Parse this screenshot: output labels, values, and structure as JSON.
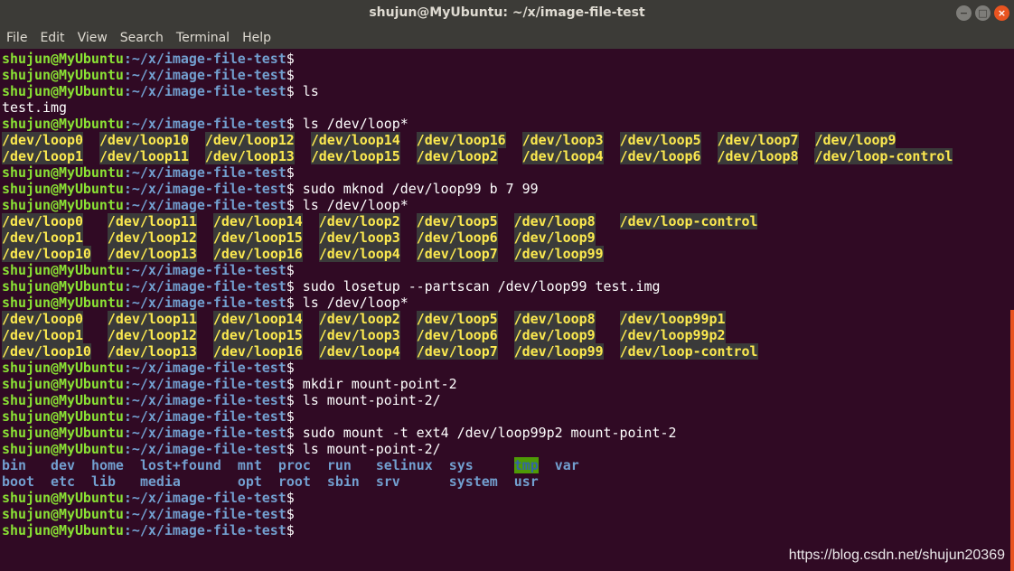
{
  "window": {
    "title": "shujun@MyUbuntu: ~/x/image-file-test",
    "buttons": {
      "minimize": "−",
      "maximize": "□",
      "close": "×"
    }
  },
  "menu": [
    "File",
    "Edit",
    "View",
    "Search",
    "Terminal",
    "Help"
  ],
  "prompt": {
    "user": "shujun@MyUbuntu",
    "path": ":~/x/image-file-test",
    "sign": "$ "
  },
  "lines": [
    {
      "t": "p",
      "cmd": ""
    },
    {
      "t": "p",
      "cmd": ""
    },
    {
      "t": "p",
      "cmd": "ls"
    },
    {
      "t": "o",
      "segs": [
        {
          "s": "test.img",
          "c": ""
        }
      ]
    },
    {
      "t": "p",
      "cmd": "ls /dev/loop*"
    },
    {
      "t": "o",
      "segs": [
        {
          "s": "/dev/loop0",
          "c": "dev"
        },
        {
          "s": "  ",
          "c": ""
        },
        {
          "s": "/dev/loop10",
          "c": "dev"
        },
        {
          "s": "  ",
          "c": ""
        },
        {
          "s": "/dev/loop12",
          "c": "dev"
        },
        {
          "s": "  ",
          "c": ""
        },
        {
          "s": "/dev/loop14",
          "c": "dev"
        },
        {
          "s": "  ",
          "c": ""
        },
        {
          "s": "/dev/loop16",
          "c": "dev"
        },
        {
          "s": "  ",
          "c": ""
        },
        {
          "s": "/dev/loop3",
          "c": "dev"
        },
        {
          "s": "  ",
          "c": ""
        },
        {
          "s": "/dev/loop5",
          "c": "dev"
        },
        {
          "s": "  ",
          "c": ""
        },
        {
          "s": "/dev/loop7",
          "c": "dev"
        },
        {
          "s": "  ",
          "c": ""
        },
        {
          "s": "/dev/loop9",
          "c": "dev"
        }
      ]
    },
    {
      "t": "o",
      "segs": [
        {
          "s": "/dev/loop1",
          "c": "dev"
        },
        {
          "s": "  ",
          "c": ""
        },
        {
          "s": "/dev/loop11",
          "c": "dev"
        },
        {
          "s": "  ",
          "c": ""
        },
        {
          "s": "/dev/loop13",
          "c": "dev"
        },
        {
          "s": "  ",
          "c": ""
        },
        {
          "s": "/dev/loop15",
          "c": "dev"
        },
        {
          "s": "  ",
          "c": ""
        },
        {
          "s": "/dev/loop2",
          "c": "dev"
        },
        {
          "s": "   ",
          "c": ""
        },
        {
          "s": "/dev/loop4",
          "c": "dev"
        },
        {
          "s": "  ",
          "c": ""
        },
        {
          "s": "/dev/loop6",
          "c": "dev"
        },
        {
          "s": "  ",
          "c": ""
        },
        {
          "s": "/dev/loop8",
          "c": "dev"
        },
        {
          "s": "  ",
          "c": ""
        },
        {
          "s": "/dev/loop-control",
          "c": "dev"
        }
      ]
    },
    {
      "t": "p",
      "cmd": ""
    },
    {
      "t": "p",
      "cmd": "sudo mknod /dev/loop99 b 7 99"
    },
    {
      "t": "p",
      "cmd": "ls /dev/loop*"
    },
    {
      "t": "o",
      "segs": [
        {
          "s": "/dev/loop0",
          "c": "dev"
        },
        {
          "s": "   ",
          "c": ""
        },
        {
          "s": "/dev/loop11",
          "c": "dev"
        },
        {
          "s": "  ",
          "c": ""
        },
        {
          "s": "/dev/loop14",
          "c": "dev"
        },
        {
          "s": "  ",
          "c": ""
        },
        {
          "s": "/dev/loop2",
          "c": "dev"
        },
        {
          "s": "  ",
          "c": ""
        },
        {
          "s": "/dev/loop5",
          "c": "dev"
        },
        {
          "s": "  ",
          "c": ""
        },
        {
          "s": "/dev/loop8",
          "c": "dev"
        },
        {
          "s": "   ",
          "c": ""
        },
        {
          "s": "/dev/loop-control",
          "c": "dev"
        }
      ]
    },
    {
      "t": "o",
      "segs": [
        {
          "s": "/dev/loop1",
          "c": "dev"
        },
        {
          "s": "   ",
          "c": ""
        },
        {
          "s": "/dev/loop12",
          "c": "dev"
        },
        {
          "s": "  ",
          "c": ""
        },
        {
          "s": "/dev/loop15",
          "c": "dev"
        },
        {
          "s": "  ",
          "c": ""
        },
        {
          "s": "/dev/loop3",
          "c": "dev"
        },
        {
          "s": "  ",
          "c": ""
        },
        {
          "s": "/dev/loop6",
          "c": "dev"
        },
        {
          "s": "  ",
          "c": ""
        },
        {
          "s": "/dev/loop9",
          "c": "dev"
        }
      ]
    },
    {
      "t": "o",
      "segs": [
        {
          "s": "/dev/loop10",
          "c": "dev"
        },
        {
          "s": "  ",
          "c": ""
        },
        {
          "s": "/dev/loop13",
          "c": "dev"
        },
        {
          "s": "  ",
          "c": ""
        },
        {
          "s": "/dev/loop16",
          "c": "dev"
        },
        {
          "s": "  ",
          "c": ""
        },
        {
          "s": "/dev/loop4",
          "c": "dev"
        },
        {
          "s": "  ",
          "c": ""
        },
        {
          "s": "/dev/loop7",
          "c": "dev"
        },
        {
          "s": "  ",
          "c": ""
        },
        {
          "s": "/dev/loop99",
          "c": "dev"
        }
      ]
    },
    {
      "t": "p",
      "cmd": ""
    },
    {
      "t": "p",
      "cmd": "sudo losetup --partscan /dev/loop99 test.img"
    },
    {
      "t": "p",
      "cmd": "ls /dev/loop*"
    },
    {
      "t": "o",
      "segs": [
        {
          "s": "/dev/loop0",
          "c": "dev"
        },
        {
          "s": "   ",
          "c": ""
        },
        {
          "s": "/dev/loop11",
          "c": "dev"
        },
        {
          "s": "  ",
          "c": ""
        },
        {
          "s": "/dev/loop14",
          "c": "dev"
        },
        {
          "s": "  ",
          "c": ""
        },
        {
          "s": "/dev/loop2",
          "c": "dev"
        },
        {
          "s": "  ",
          "c": ""
        },
        {
          "s": "/dev/loop5",
          "c": "dev"
        },
        {
          "s": "  ",
          "c": ""
        },
        {
          "s": "/dev/loop8",
          "c": "dev"
        },
        {
          "s": "   ",
          "c": ""
        },
        {
          "s": "/dev/loop99p1",
          "c": "dev"
        }
      ]
    },
    {
      "t": "o",
      "segs": [
        {
          "s": "/dev/loop1",
          "c": "dev"
        },
        {
          "s": "   ",
          "c": ""
        },
        {
          "s": "/dev/loop12",
          "c": "dev"
        },
        {
          "s": "  ",
          "c": ""
        },
        {
          "s": "/dev/loop15",
          "c": "dev"
        },
        {
          "s": "  ",
          "c": ""
        },
        {
          "s": "/dev/loop3",
          "c": "dev"
        },
        {
          "s": "  ",
          "c": ""
        },
        {
          "s": "/dev/loop6",
          "c": "dev"
        },
        {
          "s": "  ",
          "c": ""
        },
        {
          "s": "/dev/loop9",
          "c": "dev"
        },
        {
          "s": "   ",
          "c": ""
        },
        {
          "s": "/dev/loop99p2",
          "c": "dev"
        }
      ]
    },
    {
      "t": "o",
      "segs": [
        {
          "s": "/dev/loop10",
          "c": "dev"
        },
        {
          "s": "  ",
          "c": ""
        },
        {
          "s": "/dev/loop13",
          "c": "dev"
        },
        {
          "s": "  ",
          "c": ""
        },
        {
          "s": "/dev/loop16",
          "c": "dev"
        },
        {
          "s": "  ",
          "c": ""
        },
        {
          "s": "/dev/loop4",
          "c": "dev"
        },
        {
          "s": "  ",
          "c": ""
        },
        {
          "s": "/dev/loop7",
          "c": "dev"
        },
        {
          "s": "  ",
          "c": ""
        },
        {
          "s": "/dev/loop99",
          "c": "dev"
        },
        {
          "s": "  ",
          "c": ""
        },
        {
          "s": "/dev/loop-control",
          "c": "dev"
        }
      ]
    },
    {
      "t": "p",
      "cmd": ""
    },
    {
      "t": "p",
      "cmd": "mkdir mount-point-2"
    },
    {
      "t": "p",
      "cmd": "ls mount-point-2/"
    },
    {
      "t": "p",
      "cmd": ""
    },
    {
      "t": "p",
      "cmd": "sudo mount -t ext4 /dev/loop99p2 mount-point-2"
    },
    {
      "t": "p",
      "cmd": "ls mount-point-2/"
    },
    {
      "t": "o",
      "segs": [
        {
          "s": "bin",
          "c": "dir"
        },
        {
          "s": "   ",
          "c": ""
        },
        {
          "s": "dev",
          "c": "dir"
        },
        {
          "s": "  ",
          "c": ""
        },
        {
          "s": "home",
          "c": "dir"
        },
        {
          "s": "  ",
          "c": ""
        },
        {
          "s": "lost+found",
          "c": "dir"
        },
        {
          "s": "  ",
          "c": ""
        },
        {
          "s": "mnt",
          "c": "dir"
        },
        {
          "s": "  ",
          "c": ""
        },
        {
          "s": "proc",
          "c": "dir"
        },
        {
          "s": "  ",
          "c": ""
        },
        {
          "s": "run",
          "c": "dir"
        },
        {
          "s": "   ",
          "c": ""
        },
        {
          "s": "selinux",
          "c": "dir"
        },
        {
          "s": "  ",
          "c": ""
        },
        {
          "s": "sys",
          "c": "dir"
        },
        {
          "s": "     ",
          "c": ""
        },
        {
          "s": "tmp",
          "c": "tmpdir"
        },
        {
          "s": "  ",
          "c": ""
        },
        {
          "s": "var",
          "c": "dir"
        }
      ]
    },
    {
      "t": "o",
      "segs": [
        {
          "s": "boot",
          "c": "dir"
        },
        {
          "s": "  ",
          "c": ""
        },
        {
          "s": "etc",
          "c": "dir"
        },
        {
          "s": "  ",
          "c": ""
        },
        {
          "s": "lib",
          "c": "dir"
        },
        {
          "s": "   ",
          "c": ""
        },
        {
          "s": "media",
          "c": "dir"
        },
        {
          "s": "       ",
          "c": ""
        },
        {
          "s": "opt",
          "c": "dir"
        },
        {
          "s": "  ",
          "c": ""
        },
        {
          "s": "root",
          "c": "dir"
        },
        {
          "s": "  ",
          "c": ""
        },
        {
          "s": "sbin",
          "c": "dir"
        },
        {
          "s": "  ",
          "c": ""
        },
        {
          "s": "srv",
          "c": "dir"
        },
        {
          "s": "      ",
          "c": ""
        },
        {
          "s": "system",
          "c": "dir"
        },
        {
          "s": "  ",
          "c": ""
        },
        {
          "s": "usr",
          "c": "dir"
        }
      ]
    },
    {
      "t": "p",
      "cmd": ""
    },
    {
      "t": "p",
      "cmd": ""
    },
    {
      "t": "p",
      "cmd": ""
    }
  ],
  "watermark": "https://blog.csdn.net/shujun20369",
  "colors": {
    "background": "#300a24",
    "prompt_user": "#8ae234",
    "prompt_path": "#729fcf",
    "device": "#fce94f",
    "directory": "#729fcf",
    "accent": "#e95420"
  }
}
